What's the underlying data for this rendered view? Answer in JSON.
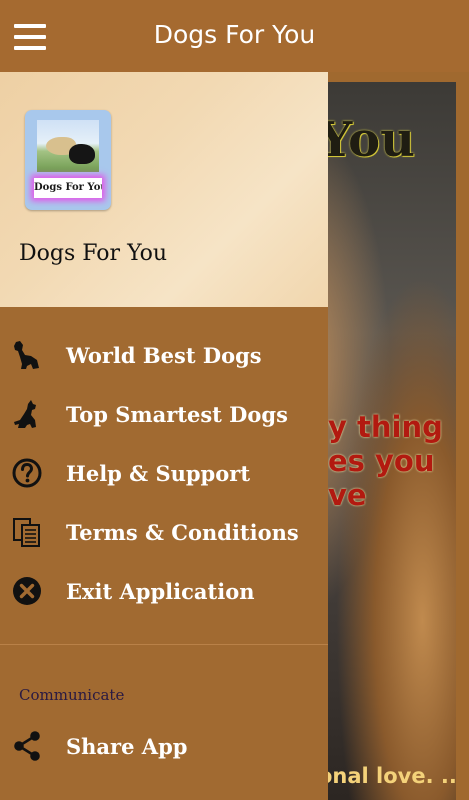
{
  "appbar": {
    "title": "Dogs For You",
    "menu_icon": "hamburger-menu-icon"
  },
  "background": {
    "headline": "You",
    "quote_lines": [
      "y thing",
      "es you",
      "ve"
    ],
    "footer": "onal love. ..."
  },
  "drawer": {
    "header": {
      "logo_text": "Dogs For You",
      "app_name": "Dogs For You"
    },
    "menu": [
      {
        "label": "World Best Dogs",
        "icon": "dog-sitting-icon"
      },
      {
        "label": "Top Smartest Dogs",
        "icon": "dog-silhouette-icon"
      },
      {
        "label": "Help & Support",
        "icon": "question-circle-icon"
      },
      {
        "label": "Terms & Conditions",
        "icon": "documents-icon"
      },
      {
        "label": "Exit Application",
        "icon": "close-circle-icon"
      }
    ],
    "section_title": "Communicate",
    "share": {
      "label": "Share App",
      "icon": "share-icon"
    }
  },
  "colors": {
    "appbar": "#a56a30",
    "drawer": "#a16a31",
    "header_gradient_light": "#f6e4c6",
    "quote_red": "#b21a10"
  }
}
